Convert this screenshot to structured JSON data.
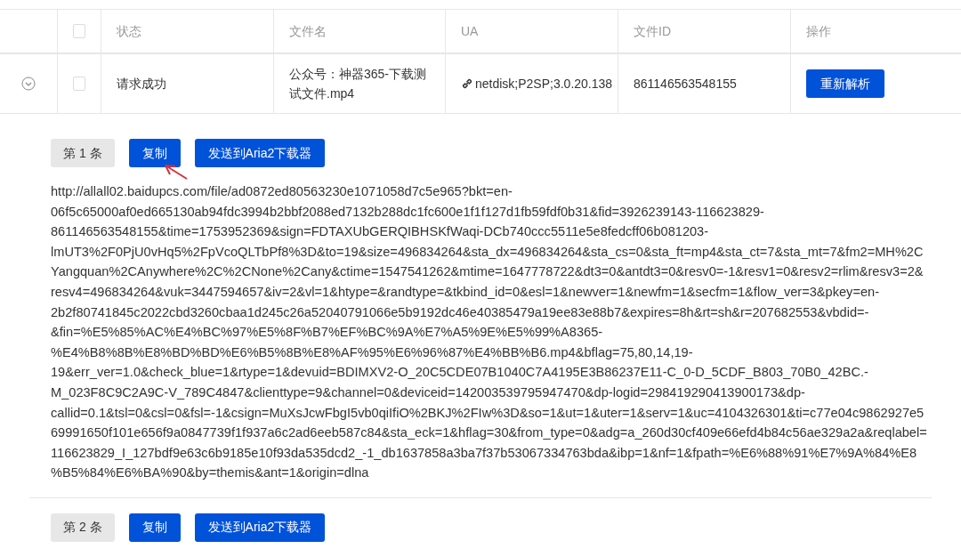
{
  "table": {
    "columns": [
      "状态",
      "文件名",
      "UA",
      "文件ID",
      "操作"
    ],
    "header_checked": false,
    "rows": [
      {
        "expanded": true,
        "checked": false,
        "status": "请求成功",
        "filename": "公众号：神器365-下载测试文件.mp4",
        "ua": "netdisk;P2SP;3.0.20.138",
        "file_id": "861146563548155",
        "action": "重新解析"
      }
    ]
  },
  "results": [
    {
      "label": "第 1 条",
      "buttons": [
        "复制",
        "发送到Aria2下载器"
      ],
      "url": "http://allall02.baidupcs.com/file/ad0872ed80563230e1071058d7c5e965?bkt=en-06f5c65000af0ed665130ab94fdc3994b2bbf2088ed7132b288dc1fc600e1f1f127d1fb59fdf0b31&fid=3926239143-116623829-861146563548155&time=1753952369&sign=FDTAXUbGERQIBHSKfWaqi-DCb740ccc5511e5e8fedcff06b081203-lmUT3%2F0PjU0vHq5%2FpVcoQLTbPf8%3D&to=19&size=496834264&sta_dx=496834264&sta_cs=0&sta_ft=mp4&sta_ct=7&sta_mt=7&fm2=MH%2CYangquan%2CAnywhere%2C%2CNone%2Cany&ctime=1547541262&mtime=1647778722&dt3=0&antdt3=0&resv0=-1&resv1=0&resv2=rlim&resv3=2&resv4=496834264&vuk=3447594657&iv=2&vl=1&htype=&randtype=&tkbind_id=0&esl=1&newver=1&newfm=1&secfm=1&flow_ver=3&pkey=en-2b2f80741845c2022cbd3260cbaa1d245c26a52040791066e5b9192dc46e40385479a19ee83e88b7&expires=8h&rt=sh&r=207682553&vbdid=-&fin=%E5%85%AC%E4%BC%97%E5%8F%B7%EF%BC%9A%E7%A5%9E%E5%99%A8365-%E4%B8%8B%E8%BD%BD%E6%B5%8B%E8%AF%95%E6%96%87%E4%BB%B6.mp4&bflag=75,80,14,19-19&err_ver=1.0&check_blue=1&rtype=1&devuid=BDIMXV2-O_20C5CDE07B1040C7A4195E3B86237E11-C_0-D_5CDF_B803_70B0_42BC.-M_023F8C9C2A9C-V_789C4847&clienttype=9&channel=0&deviceid=142003539795947470&dp-logid=298419290413900173&dp-callid=0.1&tsl=0&csl=0&fsl=-1&csign=MuXsJcwFbgI5vb0qiIfiO%2BKJ%2FIw%3D&so=1&ut=1&uter=1&serv=1&uc=4104326301&ti=c77e04c9862927e569991650f101e656f9a0847739f1f937a6c2ad6eeb587c84&sta_eck=1&hflag=30&from_type=0&adg=a_260d30cf409e66efd4b84c56ae329a2a&reqlabel=116623829_I_127bdf9e63c6b9185e10f93da535dcd2_-1_db1637858a3ba7f37b53067334763bda&ibp=1&nf=1&fpath=%E6%88%91%E7%9A%84%E8%B5%84%E6%BA%90&by=themis&ant=1&origin=dlna"
    },
    {
      "label": "第 2 条",
      "buttons": [
        "复制",
        "发送到Aria2下载器"
      ]
    }
  ]
}
